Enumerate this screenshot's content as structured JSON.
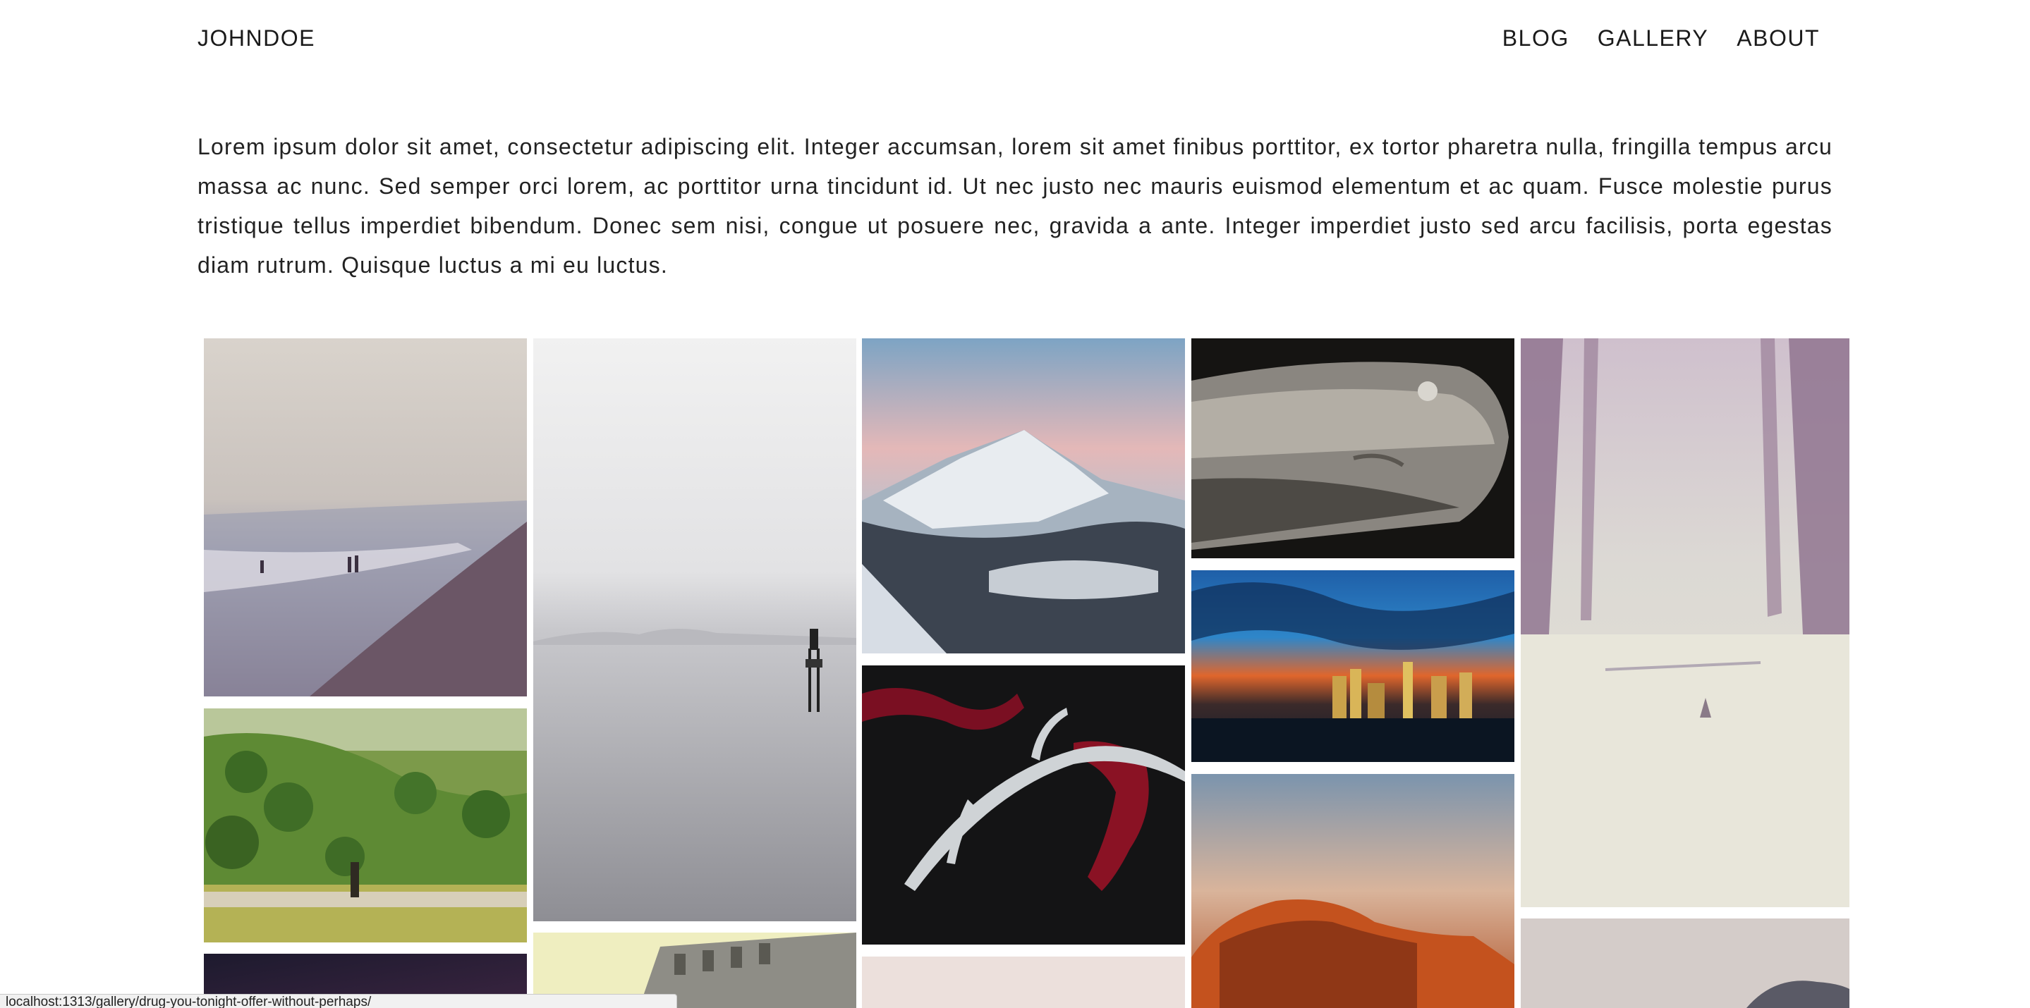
{
  "header": {
    "brand": "JOHNDOE",
    "nav": [
      "BLOG",
      "GALLERY",
      "ABOUT"
    ]
  },
  "intro": {
    "text": "Lorem ipsum dolor sit amet, consectetur adipiscing elit. Integer accumsan, lorem sit amet finibus porttitor, ex tortor pharetra nulla, fringilla tempus arcu massa ac nunc. Sed semper orci lorem, ac porttitor urna tincidunt id. Ut nec justo nec mauris euismod elementum et ac quam. Fusce molestie purus tristique tellus imperdiet bibendum. Donec sem nisi, congue ut posuere nec, gravida a ante. Integer imperdiet justo sed arcu facilisis, porta egestas diam rutrum. Quisque luctus a mi eu luctus."
  },
  "gallery": {
    "photos": [
      {
        "subject": "misty beach with people wading"
      },
      {
        "subject": "green hills with shepherd and sheep"
      },
      {
        "subject": "dark night sky"
      },
      {
        "subject": "calm grey sea with tower"
      },
      {
        "subject": "old building facade"
      },
      {
        "subject": "snowy mountain peak at dusk"
      },
      {
        "subject": "antler with red scarf on black"
      },
      {
        "subject": "pale pink image"
      },
      {
        "subject": "vintage car close-up"
      },
      {
        "subject": "city skyline at sunset"
      },
      {
        "subject": "red rock formation"
      },
      {
        "subject": "foggy forest road"
      },
      {
        "subject": "coastal hillside"
      }
    ]
  },
  "status": {
    "url": "localhost:1313/gallery/drug-you-tonight-offer-without-perhaps/"
  },
  "colors": {
    "text": "#1a1a1a",
    "background": "#ffffff"
  }
}
